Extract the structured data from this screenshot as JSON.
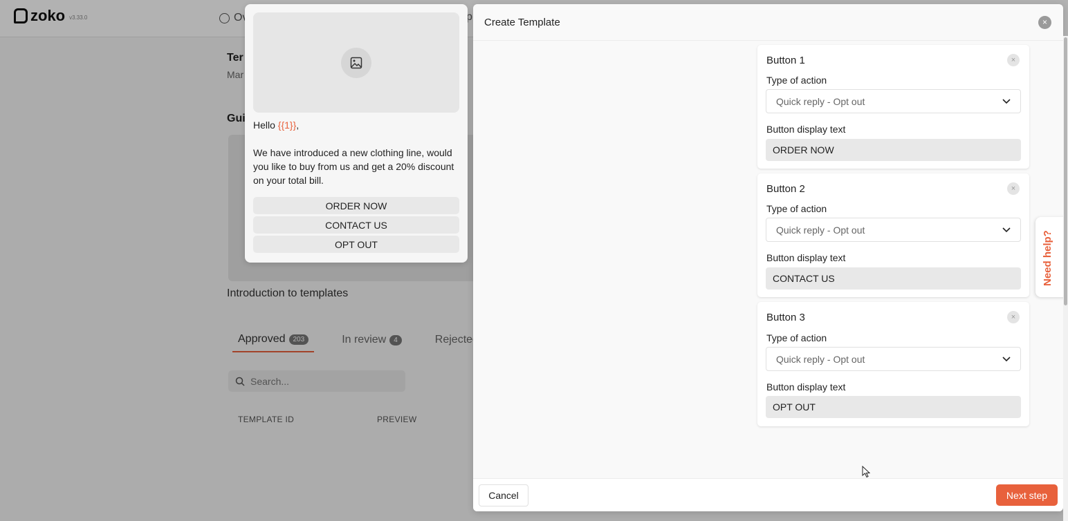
{
  "app": {
    "brand": "zoko",
    "version": "v3.33.0",
    "nav_overview": "Ov",
    "nav_partial": "p",
    "page_title_partial": "Ter",
    "page_sub_partial": "Mar",
    "guide_title_partial": "Gui",
    "intro_link": "Introduction to templates",
    "tabs": [
      {
        "label": "Approved",
        "count": "203"
      },
      {
        "label": "In review",
        "count": "4"
      },
      {
        "label": "Rejected",
        "count": ""
      }
    ],
    "search_placeholder": "Search...",
    "columns": [
      "TEMPLATE ID",
      "PREVIEW"
    ]
  },
  "preview": {
    "hello": "Hello ",
    "variable": "{{1}}",
    "hello_suffix": ",",
    "body": "We have introduced a new clothing line, would you like to buy from us and get a 20% discount on your total bill.",
    "buttons": [
      "ORDER NOW",
      "CONTACT US",
      "OPT OUT"
    ]
  },
  "modal": {
    "title": "Create Template",
    "close_symbol": "×",
    "type_label": "Type of action",
    "display_label": "Button display text",
    "buttons": [
      {
        "title": "Button 1",
        "action": "Quick reply - Opt out",
        "text": "ORDER NOW"
      },
      {
        "title": "Button 2",
        "action": "Quick reply - Opt out",
        "text": "CONTACT US"
      },
      {
        "title": "Button 3",
        "action": "Quick reply - Opt out",
        "text": "OPT OUT"
      }
    ],
    "cancel": "Cancel",
    "next": "Next step"
  },
  "help": "Need help?",
  "colors": {
    "accent": "#e8613c"
  }
}
